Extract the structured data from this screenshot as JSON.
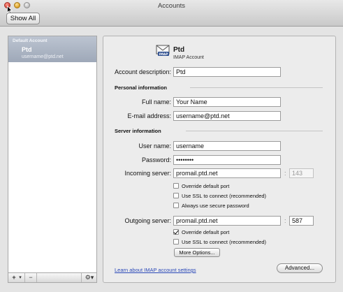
{
  "window": {
    "title": "Accounts"
  },
  "toolbar": {
    "show_all_label": "Show All"
  },
  "sidebar": {
    "group_label": "Default Account",
    "account_name": "Ptd",
    "account_email": "username@ptd.net",
    "add_label": "+",
    "remove_label": "−",
    "action_label": "⚙▾",
    "add_menu_arrow": "▾"
  },
  "account": {
    "name": "Ptd",
    "type": "IMAP Account",
    "description_label": "Account description:",
    "description_value": "Ptd"
  },
  "personal": {
    "section_label": "Personal information",
    "full_name_label": "Full name:",
    "full_name_value": "Your Name",
    "email_label": "E-mail address:",
    "email_value": "username@ptd.net"
  },
  "server": {
    "section_label": "Server information",
    "user_name_label": "User name:",
    "user_name_value": "username",
    "password_label": "Password:",
    "password_value": "••••••••",
    "incoming_label": "Incoming server:",
    "incoming_value": "promail.ptd.net",
    "incoming_port": "143",
    "incoming_override_label": "Override default port",
    "incoming_override_checked": false,
    "incoming_ssl_label": "Use SSL to connect (recommended)",
    "incoming_ssl_checked": false,
    "secure_password_label": "Always use secure password",
    "secure_password_checked": false,
    "outgoing_label": "Outgoing server:",
    "outgoing_value": "promail.ptd.net",
    "outgoing_port": "587",
    "outgoing_override_label": "Override default port",
    "outgoing_override_checked": true,
    "outgoing_ssl_label": "Use SSL to connect (recommended)",
    "outgoing_ssl_checked": false,
    "more_options_label": "More Options...",
    "colon": ":"
  },
  "footer": {
    "learn_link": "Learn about IMAP account settings",
    "advanced_label": "Advanced..."
  }
}
